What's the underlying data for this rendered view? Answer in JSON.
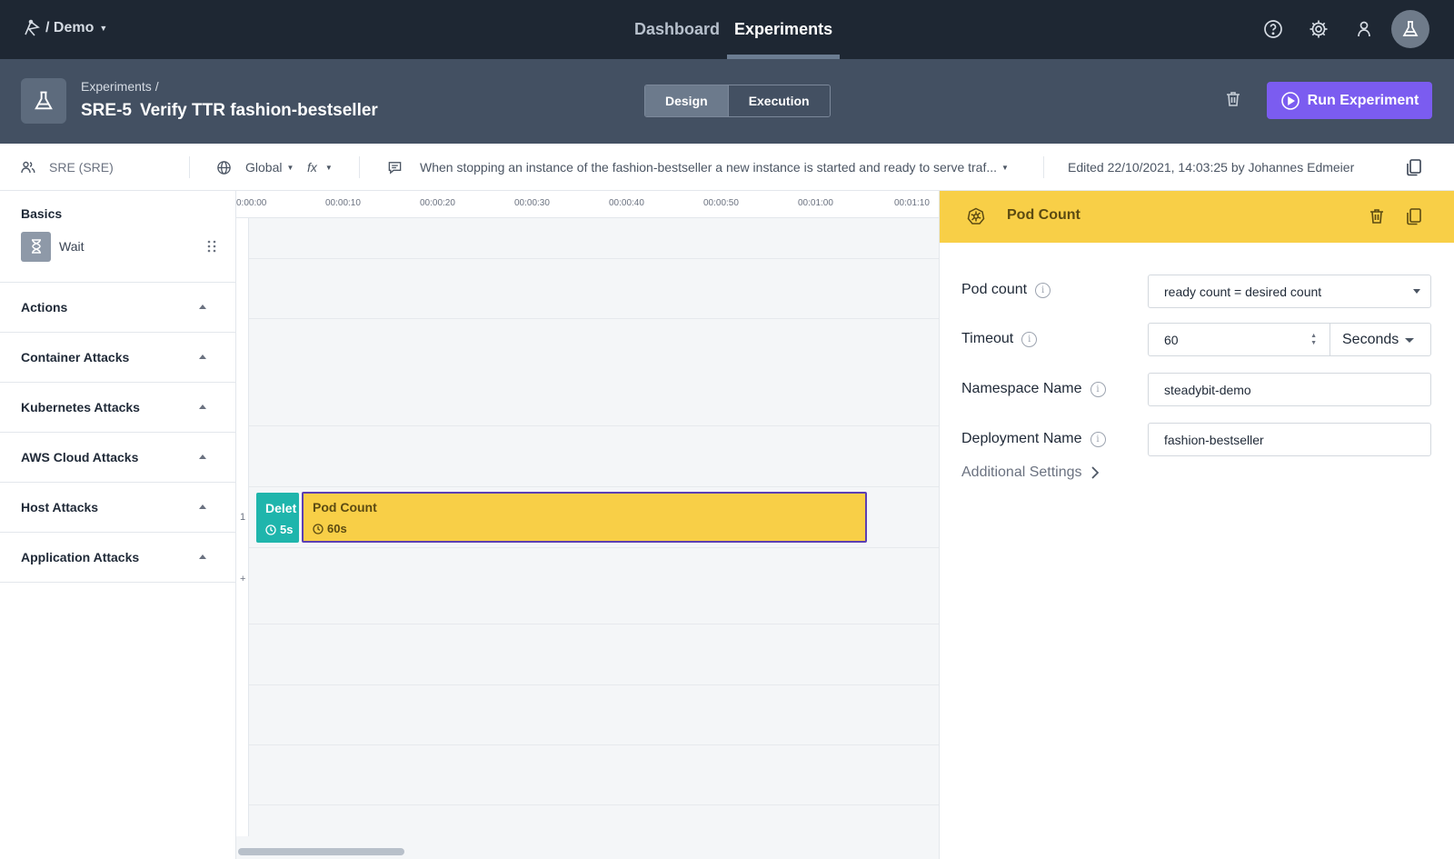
{
  "nav": {
    "brand": "/ Demo",
    "tabs": [
      {
        "label": "Dashboard",
        "active": false
      },
      {
        "label": "Experiments",
        "active": true
      }
    ]
  },
  "header": {
    "breadcrumb": "Experiments /",
    "key": "SRE-5",
    "title": "Verify TTR fashion-bestseller",
    "modes": [
      {
        "label": "Design",
        "active": true
      },
      {
        "label": "Execution",
        "active": false
      }
    ],
    "run_label": "Run Experiment"
  },
  "infobar": {
    "team": "SRE (SRE)",
    "environment": "Global",
    "fx": "fx",
    "hypothesis": "When stopping an instance of the fashion-bestseller a new instance is started and ready to serve traf...",
    "edited": "Edited 22/10/2021, 14:03:25 by Johannes Edmeier"
  },
  "sidebar": {
    "basics_title": "Basics",
    "wait_label": "Wait",
    "sections": [
      "Actions",
      "Container Attacks",
      "Kubernetes Attacks",
      "AWS Cloud Attacks",
      "Host Attacks",
      "Application Attacks"
    ]
  },
  "timeline": {
    "ticks": [
      "0:00:00",
      "00:00:10",
      "00:00:20",
      "00:00:30",
      "00:00:40",
      "00:00:50",
      "00:01:00",
      "00:01:10"
    ],
    "row_label": "1",
    "add_lane": "+",
    "steps": [
      {
        "label": "Delet",
        "duration": "5s"
      },
      {
        "label": "Pod Count",
        "duration": "60s"
      }
    ]
  },
  "panel": {
    "title": "Pod Count",
    "fields": {
      "pod_count_label": "Pod count",
      "pod_count_value": "ready count = desired count",
      "timeout_label": "Timeout",
      "timeout_value": "60",
      "timeout_unit": "Seconds",
      "namespace_label": "Namespace Name",
      "namespace_value": "steadybit-demo",
      "deployment_label": "Deployment Name",
      "deployment_value": "fashion-bestseller"
    },
    "additional_settings": "Additional Settings",
    "info_glyph": "i"
  },
  "colors": {
    "accent": "#7b5cf0",
    "step_teal": "#1fb5ac",
    "step_yellow": "#f8cf47",
    "nav_bg": "#1e2733",
    "header_bg": "#435062"
  }
}
